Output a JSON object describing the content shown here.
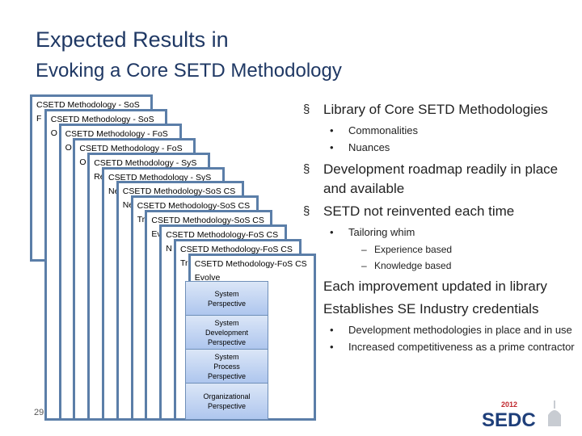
{
  "title": {
    "line1": "Expected Results in",
    "line2": "Evoking a Core SETD Methodology"
  },
  "cards": [
    {
      "title": "CSETD  Methodology - SoS",
      "sub": "F"
    },
    {
      "title": "CSETD  Methodology - SoS",
      "sub": "O"
    },
    {
      "title": "CSETD  Methodology - FoS",
      "sub": "O"
    },
    {
      "title": "CSETD  Methodology - FoS",
      "sub": "O"
    },
    {
      "title": "CSETD  Methodology - SyS",
      "sub": "Re"
    },
    {
      "title": "CSETD  Methodology - SyS",
      "sub": "Ne"
    },
    {
      "title": "CSETD  Methodology-SoS CS",
      "sub": "Ne"
    },
    {
      "title": "CSETD  Methodology-SoS CS",
      "sub": "Tr"
    },
    {
      "title": "CSETD  Methodology-SoS CS",
      "sub": "Ev"
    },
    {
      "title": "CSETD  Methodology-FoS CS",
      "sub": "N"
    },
    {
      "title": "CSETD  Methodology-FoS CS",
      "sub": "Tr"
    },
    {
      "title": "CSETD  Methodology-FoS CS",
      "sub": "Evolve"
    }
  ],
  "partial_text": "2",
  "page_number": "29",
  "perspectives": [
    "System\nPerspective",
    "System\nDevelopment\nPerspective",
    "System\nProcess\nPerspective",
    "Organizational\nPerspective"
  ],
  "bullets": {
    "b1": "Library of Core SETD Methodologies",
    "b1a": "Commonalities",
    "b1b": "Nuances",
    "b2": "Development roadmap readily in place and available",
    "b3": "SETD  not reinvented each time",
    "b3a": "Tailoring whim",
    "b3a1": "Experience based",
    "b3a2": "Knowledge based",
    "b4": "Each improvement updated in library",
    "b5": "Establishes SE Industry credentials",
    "b5a": "Development methodologies in place and in use",
    "b5b": "Increased competitiveness as a prime contractor"
  },
  "logo": {
    "year": "2012",
    "text": "SEDC"
  },
  "colors": {
    "title": "#1f3864",
    "card_border": "#5b7ea8",
    "logo_red": "#c0272d",
    "logo_blue": "#1f3f7a"
  }
}
